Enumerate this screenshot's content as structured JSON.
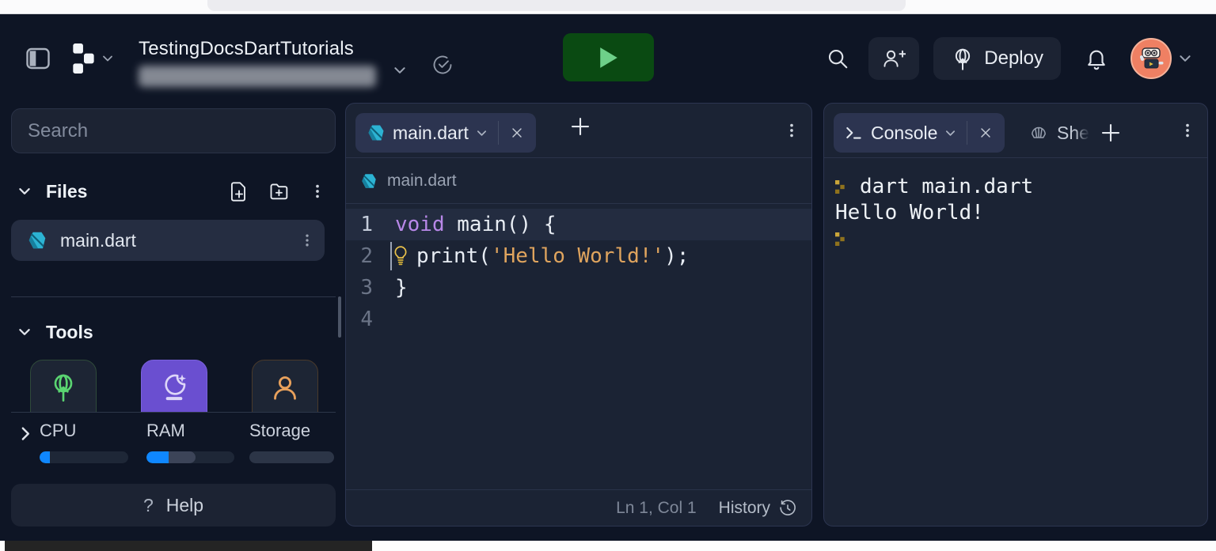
{
  "header": {
    "title": "TestingDocsDartTutorials",
    "deploy_label": "Deploy"
  },
  "sidebar": {
    "search_placeholder": "Search",
    "files_label": "Files",
    "file_name": "main.dart",
    "tools_label": "Tools",
    "tool_tiles": [
      {
        "icon": "deployments-globe-arrow-icon",
        "accent": "#5ad471"
      },
      {
        "icon": "ai-crystal-ball-icon",
        "accent": "#6a4fd0"
      },
      {
        "icon": "account-person-icon",
        "accent": "#e8a15c"
      }
    ],
    "meters": [
      {
        "label": "CPU",
        "fill_pct": 12,
        "secondary_pct": 0
      },
      {
        "label": "RAM",
        "fill_pct": 25,
        "secondary_pct": 31
      },
      {
        "label": "Storage",
        "fill_pct": 0,
        "secondary_pct": 0
      }
    ],
    "help_icon": "?",
    "help_label": "Help"
  },
  "editor": {
    "tab_label": "main.dart",
    "breadcrumb": "main.dart",
    "code": {
      "line1": {
        "num": "1",
        "keyword": "void",
        "rest": " main() {"
      },
      "line2": {
        "num": "2",
        "indent_pre": "print(",
        "string": "'Hello World!'",
        "post": ");"
      },
      "line3": {
        "num": "3",
        "text": "}"
      },
      "line4": {
        "num": "4"
      }
    },
    "status_position": "Ln 1, Col 1",
    "history_label": "History"
  },
  "console": {
    "tab_label": "Console",
    "shell_tab_label": "She",
    "command": "dart main.dart",
    "output": "Hello World!"
  },
  "colors": {
    "app_background": "#0e1525",
    "panel_surface": "#1c2333",
    "accent_blue": "#0f87ff",
    "run_button_green": "#0a4a12",
    "play_triangle_green": "#6ed089",
    "prompt_yellow": "#b08a1e",
    "string_orange": "#dfa45e",
    "keyword_purple": "#b888e8",
    "dart_teal": "#2cb3d3",
    "avatar_coral": "#ef8063",
    "ai_tile_purple": "#6a4fd0"
  }
}
